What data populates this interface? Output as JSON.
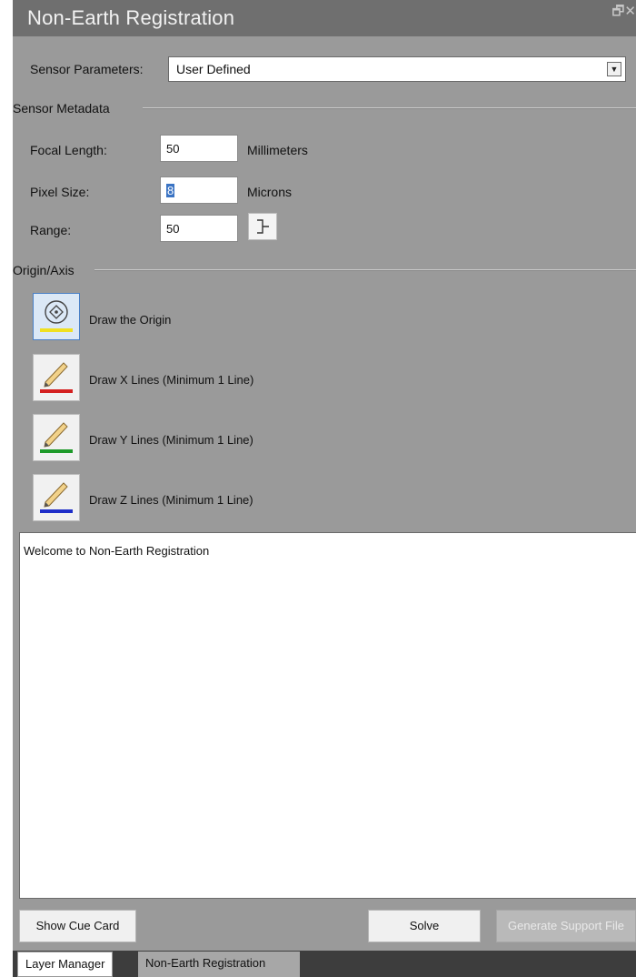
{
  "window": {
    "title": "Non-Earth Registration",
    "restore_glyph": "🗗",
    "close_glyph": "✕"
  },
  "sensor_parameters": {
    "label": "Sensor Parameters:",
    "selected": "User Defined",
    "dropdown_arrow": "▼"
  },
  "sensor_metadata": {
    "section_label": "Sensor Metadata",
    "focal_length": {
      "label": "Focal Length:",
      "value": "50",
      "unit": "Millimeters"
    },
    "pixel_size": {
      "label": "Pixel Size:",
      "value": "8",
      "unit": "Microns"
    },
    "range": {
      "label": "Range:",
      "value": "50",
      "button_icon": "range-bracket-icon"
    }
  },
  "origin_axis": {
    "section_label": "Origin/Axis",
    "tools": [
      {
        "label": "Draw the Origin",
        "icon": "origin-target-icon",
        "color": "#f0e020",
        "active": true
      },
      {
        "label": "Draw X Lines (Minimum 1 Line)",
        "icon": "pencil-icon",
        "color": "#d42020",
        "active": false
      },
      {
        "label": "Draw Y Lines (Minimum 1 Line)",
        "icon": "pencil-icon",
        "color": "#1e9a2a",
        "active": false
      },
      {
        "label": "Draw Z Lines (Minimum 1 Line)",
        "icon": "pencil-icon",
        "color": "#1e2ec8",
        "active": false
      }
    ]
  },
  "log": {
    "text": "Welcome to Non-Earth Registration"
  },
  "buttons": {
    "show_cue_card": "Show Cue Card",
    "solve": "Solve",
    "generate_support_file": "Generate Support File"
  },
  "tabs": [
    {
      "label": "Layer Manager",
      "active": false
    },
    {
      "label": "Non-Earth Registration",
      "active": true
    }
  ]
}
